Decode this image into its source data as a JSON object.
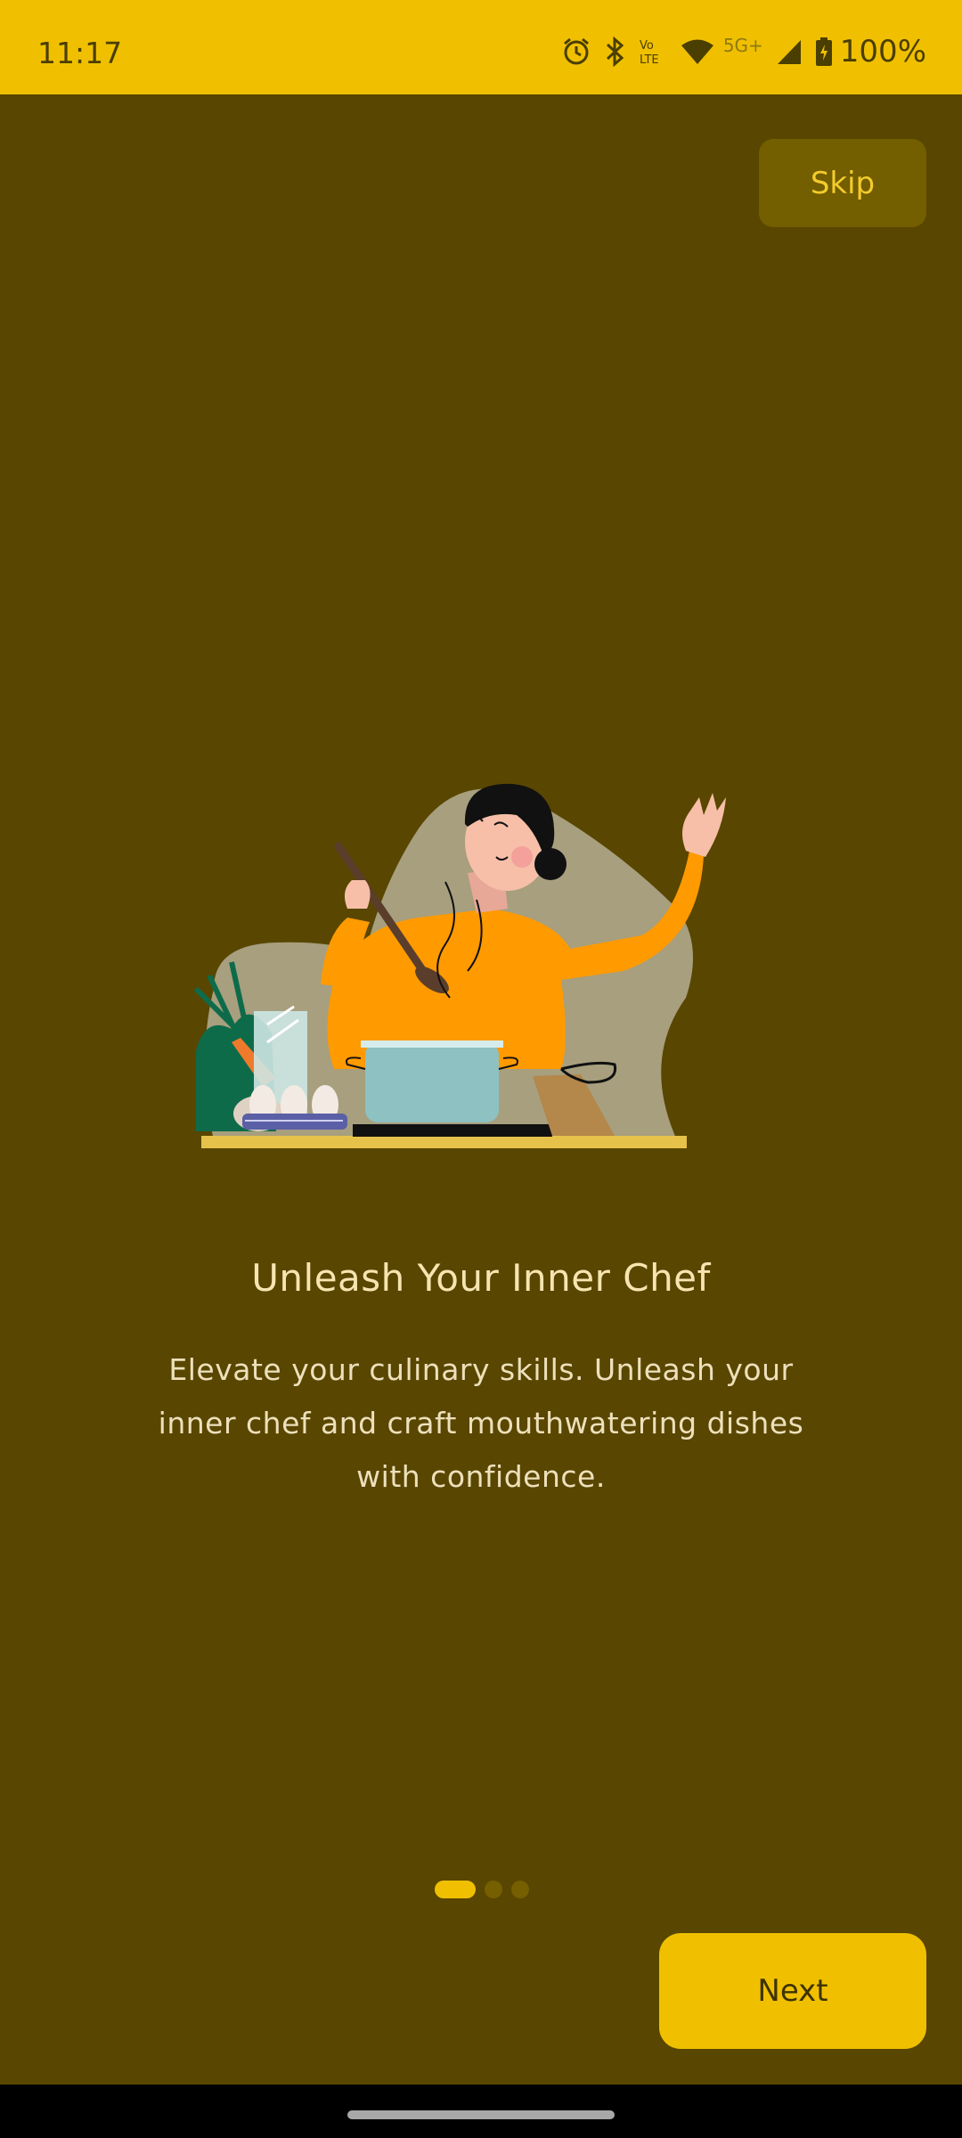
{
  "status_bar": {
    "time": "11:17",
    "battery": "100%",
    "network": "5G+",
    "icons": [
      "alarm-icon",
      "bluetooth-icon",
      "volte-icon",
      "wifi-icon",
      "signal-icon",
      "battery-charging-icon"
    ]
  },
  "onboarding": {
    "skip_label": "Skip",
    "title": "Unleash Your Inner Chef",
    "description": "Elevate your culinary skills. Unleash your inner chef and craft mouthwatering dishes with confidence.",
    "page_count": 3,
    "current_page": 1,
    "next_label": "Next"
  },
  "colors": {
    "accent": "#F0C000",
    "background": "#594600",
    "title_text": "#F6E5B0"
  }
}
